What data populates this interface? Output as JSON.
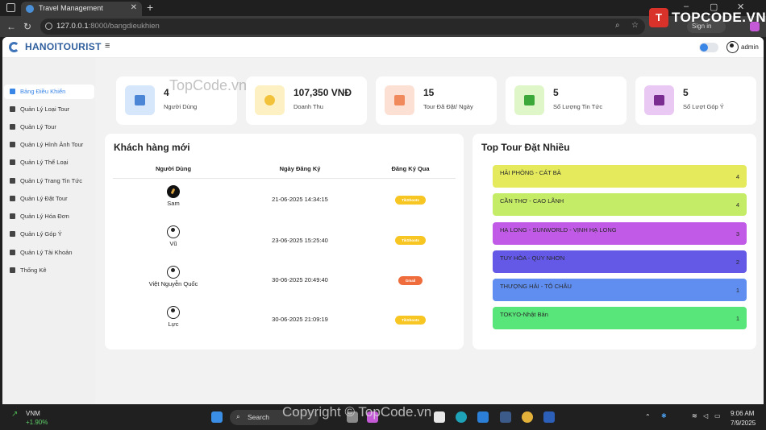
{
  "browser": {
    "tab_title": "Travel Management",
    "url_host": "127.0.0.1",
    "url_path": ":8000/bangdieukhien",
    "signin_label": "Sign in"
  },
  "brand_overlay": "TOPCODE.VN",
  "app": {
    "logo_text": "HANOITOURIST",
    "menu_icon": "≡",
    "user_name": "admin"
  },
  "sidebar": {
    "items": [
      {
        "label": "Bảng Điều Khiển",
        "icon": "grid-icon",
        "active": true
      },
      {
        "label": "Quản Lý Loại Tour",
        "icon": "list-icon"
      },
      {
        "label": "Quản Lý Tour",
        "icon": "list-icon"
      },
      {
        "label": "Quản Lý Hình Ảnh Tour",
        "icon": "image-icon"
      },
      {
        "label": "Quản Lý Thể Loại",
        "icon": "tag-icon"
      },
      {
        "label": "Quản Lý Trang Tin Tức",
        "icon": "news-icon"
      },
      {
        "label": "Quản Lý Đặt Tour",
        "icon": "booking-icon"
      },
      {
        "label": "Quản Lý Hóa Đơn",
        "icon": "folder-icon"
      },
      {
        "label": "Quản Lý Góp Ý",
        "icon": "feedback-icon"
      },
      {
        "label": "Quản Lý Tài Khoản",
        "icon": "user-icon"
      },
      {
        "label": "Thống Kê",
        "icon": "chart-icon"
      }
    ]
  },
  "stats": [
    {
      "value": "4",
      "label": "Người Dùng",
      "icon": "users-icon",
      "bg": "#d6e6fb",
      "fg": "#4b86d6"
    },
    {
      "value": "107,350 VNĐ",
      "label": "Doanh Thu",
      "icon": "coin-icon",
      "bg": "#fdf1c4",
      "fg": "#f2c23a"
    },
    {
      "value": "15",
      "label": "Tour Đã Đặt/ Ngày",
      "icon": "calendar-icon",
      "bg": "#fde0d4",
      "fg": "#f08a5d"
    },
    {
      "value": "5",
      "label": "Số Lượng Tin Tức",
      "icon": "document-icon",
      "bg": "#dff6c9",
      "fg": "#3ca83a"
    },
    {
      "value": "5",
      "label": "Số Lượt Góp Ý",
      "icon": "message-icon",
      "bg": "#e9c8f3",
      "fg": "#7a2c90"
    }
  ],
  "customers": {
    "title": "Khách hàng mới",
    "columns": [
      "Người Dùng",
      "Ngày Đăng Ký",
      "Đăng Ký Qua"
    ],
    "rows": [
      {
        "name": "Sam",
        "date": "21-06-2025 14:34:15",
        "via": "TikShoots",
        "avatar": "photo",
        "badge_color": "#f7c623"
      },
      {
        "name": "Vũ",
        "date": "23-06-2025 15:25:40",
        "via": "TikShoots",
        "avatar": "default",
        "badge_color": "#f7c623"
      },
      {
        "name": "Việt Nguyễn Quốc",
        "date": "30-06-2025 20:49:40",
        "via": "Gmail",
        "avatar": "default",
        "badge_color": "#ef6c3c"
      },
      {
        "name": "Lực",
        "date": "30-06-2025 21:09:19",
        "via": "TikShoots",
        "avatar": "default",
        "badge_color": "#f7c623"
      }
    ]
  },
  "top_tours": {
    "title": "Top Tour Đặt Nhiều",
    "items": [
      {
        "name": "HẢI PHÒNG - CÁT BÀ",
        "count": "4",
        "color": "#e4ea5c"
      },
      {
        "name": "CẦN THƠ - CAO LÃNH",
        "count": "4",
        "color": "#c5ec67"
      },
      {
        "name": "HẠ LONG - SUNWORLD - VỊNH HẠ LONG",
        "count": "3",
        "color": "#c15ae6"
      },
      {
        "name": "TUY HÒA - QUY NHƠN",
        "count": "2",
        "color": "#6359e6"
      },
      {
        "name": "THƯỢNG HẢI - TÔ CHÂU",
        "count": "1",
        "color": "#5f8ef0"
      },
      {
        "name": "TOKYO-Nhật Bản",
        "count": "1",
        "color": "#58e57a"
      }
    ]
  },
  "watermarks": {
    "content": "TopCode.vn",
    "taskbar": "Copyright © TopCode.vn"
  },
  "taskbar": {
    "stock_ticker": "VNM",
    "stock_change": "+1.90%",
    "search_label": "Search",
    "time": "9:06 AM",
    "date": "7/9/2025"
  }
}
